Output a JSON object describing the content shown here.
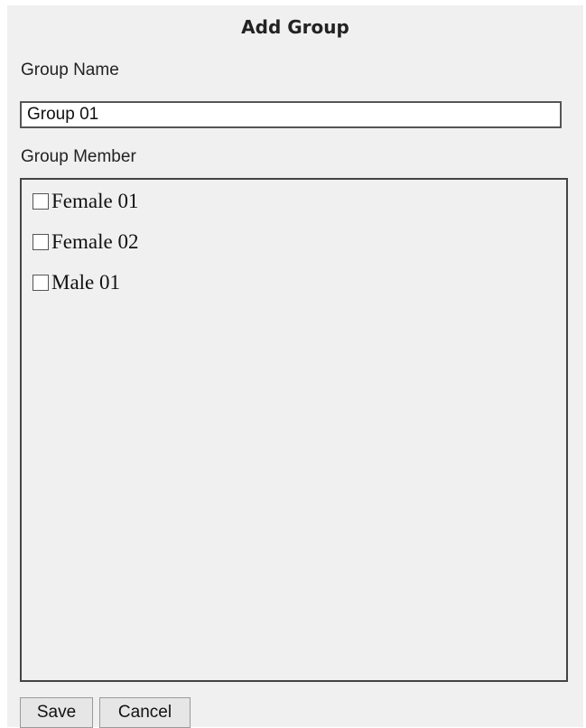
{
  "dialog": {
    "title": "Add Group",
    "group_name_label": "Group Name",
    "group_name_value": "Group 01",
    "group_member_label": "Group Member",
    "members": [
      {
        "label": "Female 01",
        "checked": false
      },
      {
        "label": "Female 02",
        "checked": false
      },
      {
        "label": "Male 01",
        "checked": false
      }
    ],
    "save_label": "Save",
    "cancel_label": "Cancel"
  },
  "colors": {
    "dialog_background": "#f0f0f0",
    "border": "#444444",
    "button_background": "#e6e6e6"
  }
}
